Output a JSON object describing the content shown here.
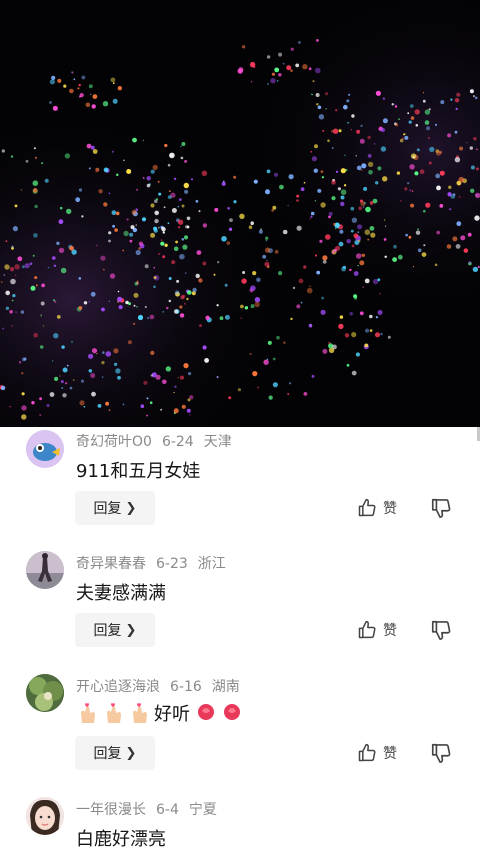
{
  "comments": [
    {
      "username": "奇幻荷叶O0",
      "date": "6-24",
      "location": "天津",
      "text": "911和五月女娃",
      "reply_label": "回复",
      "like_label": "赞"
    },
    {
      "username": "奇异果春春",
      "date": "6-23",
      "location": "浙江",
      "text": "夫妻感满满",
      "reply_label": "回复",
      "like_label": "赞"
    },
    {
      "username": "开心追逐海浪",
      "date": "6-16",
      "location": "湖南",
      "text": "好听",
      "reply_label": "回复",
      "like_label": "赞"
    },
    {
      "username": "一年很漫长",
      "date": "6-4",
      "location": "宁夏",
      "text": "白鹿好漂亮"
    }
  ],
  "icons": {
    "reply_chevron": "chevron-right-icon",
    "like": "thumbs-up-icon",
    "dislike": "thumbs-down-icon",
    "heart_hand": "finger-heart-emoji",
    "rose": "rose-emoji"
  }
}
